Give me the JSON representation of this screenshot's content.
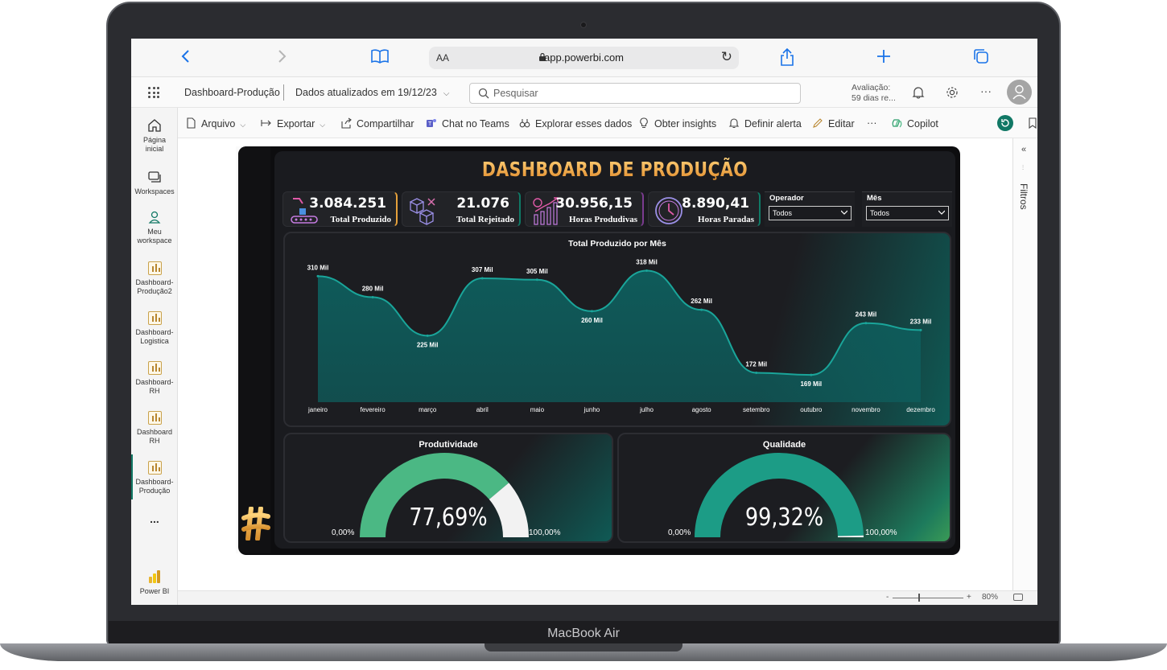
{
  "device": {
    "label": "MacBook Air"
  },
  "browser": {
    "url_aa": "AA",
    "url": "app.powerbi.com"
  },
  "pbi_header": {
    "report_name": "Dashboard-Produção",
    "data_updated": "Dados atualizados em 19/12/23",
    "search_placeholder": "Pesquisar",
    "trial_line1": "Avaliação:",
    "trial_line2": "59 dias re..."
  },
  "left_nav": [
    {
      "label": "Página inicial",
      "icon": "home-icon"
    },
    {
      "label": "Workspaces",
      "icon": "workspaces-icon"
    },
    {
      "label": "Meu workspace",
      "icon": "person-icon"
    },
    {
      "label": "Dashboard-Produção2",
      "icon": "report-icon"
    },
    {
      "label": "Dashboard-Logistica",
      "icon": "report-icon"
    },
    {
      "label": "Dashboard-RH",
      "icon": "report-icon"
    },
    {
      "label": "Dashboard RH",
      "icon": "report-icon"
    },
    {
      "label": "Dashboard-Produção",
      "icon": "report-icon",
      "active": true
    },
    {
      "label": "...",
      "icon": "more-icon"
    },
    {
      "label": "Power BI",
      "icon": "powerbi-logo"
    }
  ],
  "nav_labels": {
    "home_1": "Página",
    "home_2": "inicial",
    "workspaces": "Workspaces",
    "my_1": "Meu",
    "my_2": "workspace",
    "r1_1": "Dashboard-",
    "r1_2": "Produção2",
    "r2_1": "Dashboard-",
    "r2_2": "Logistica",
    "r3_1": "Dashboard-",
    "r3_2": "RH",
    "r4_1": "Dashboard",
    "r4_2": "RH",
    "r5_1": "Dashboard-",
    "r5_2": "Produção",
    "more": "...",
    "powerbi": "Power BI"
  },
  "toolbar": {
    "arquivo": "Arquivo",
    "exportar": "Exportar",
    "compartilhar": "Compartilhar",
    "teams": "Chat no Teams",
    "explorar": "Explorar esses dados",
    "insights": "Obter insights",
    "alerta": "Definir alerta",
    "editar": "Editar",
    "more": "···",
    "copilot": "Copilot"
  },
  "right_pane": {
    "filters": "Filtros"
  },
  "status_bar": {
    "zoom_minus": "-",
    "zoom_plus": "+",
    "zoom": "80%"
  },
  "dashboard": {
    "title": "DASHBOARD DE PRODUÇÃO",
    "kpis": [
      {
        "value": "3.084.251",
        "label": "Total Produzido",
        "icon": "conveyor-robot-icon",
        "accent": "#e6a13b"
      },
      {
        "value": "21.076",
        "label": "Total Rejeitado",
        "icon": "boxes-icon",
        "accent": "#0f7a66"
      },
      {
        "value": "30.956,15",
        "label": "Horas Produdivas",
        "icon": "growth-chart-icon",
        "accent": "#7a3b8f"
      },
      {
        "value": "8.890,41",
        "label": "Horas Paradas",
        "icon": "clock-icon",
        "accent": "#0f7a66"
      }
    ],
    "slicers": [
      {
        "label": "Operador",
        "value": "Todos"
      },
      {
        "label": "Mês",
        "value": "Todos"
      }
    ],
    "gauges": [
      {
        "title": "Produtividade",
        "value": "77,69%",
        "fraction": 0.7769,
        "min": "0,00%",
        "max": "100,00%",
        "fill": "#4bb884",
        "rest": "#f2f2f2"
      },
      {
        "title": "Qualidade",
        "value": "99,32%",
        "fraction": 0.9932,
        "min": "0,00%",
        "max": "100,00%",
        "fill": "#1c9c86",
        "rest": "#f2f2f2"
      }
    ]
  },
  "chart_data": {
    "type": "area",
    "title": "Total Produzido por Mês",
    "categories": [
      "janeiro",
      "fevereiro",
      "março",
      "abril",
      "maio",
      "junho",
      "julho",
      "agosto",
      "setembro",
      "outubro",
      "novembro",
      "dezembro"
    ],
    "values": [
      310,
      280,
      225,
      307,
      305,
      260,
      318,
      262,
      172,
      169,
      243,
      233
    ],
    "data_labels": [
      "310 Mil",
      "280 Mil",
      "225 Mil",
      "307 Mil",
      "305 Mil",
      "260 Mil",
      "318 Mil",
      "262 Mil",
      "172 Mil",
      "169 Mil",
      "243 Mil",
      "233 Mil"
    ],
    "unit": "Mil",
    "ylim": [
      130,
      330
    ],
    "grid": false,
    "colors": {
      "line": "#1aa59a",
      "fill": "#0e5e5d"
    }
  }
}
